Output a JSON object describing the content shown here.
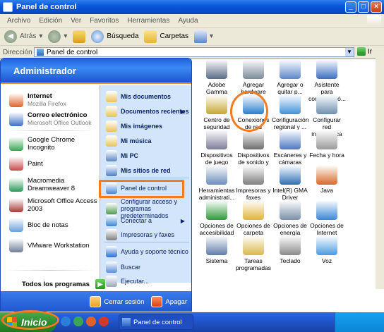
{
  "window": {
    "title": "Panel de control",
    "menus": [
      "Archivo",
      "Edición",
      "Ver",
      "Favoritos",
      "Herramientas",
      "Ayuda"
    ],
    "toolbar": {
      "back": "Atrás",
      "search": "Búsqueda",
      "folders": "Carpetas"
    },
    "address_label": "Dirección",
    "address_value": "Panel de control",
    "go": "Ir"
  },
  "control_panel": {
    "items": [
      {
        "label": "Adobe Gamma",
        "icon": "monitor-icon",
        "color": "#5a6d86"
      },
      {
        "label": "Agregar hardware",
        "icon": "hardware-icon",
        "color": "#7b8b99"
      },
      {
        "label": "Agregar o quitar p...",
        "icon": "cd-box-icon",
        "color": "#5e88c8"
      },
      {
        "label": "Asistente para configuració...",
        "icon": "wizard-icon",
        "color": "#3c6fbf"
      },
      {
        "label": "Centro de seguridad",
        "icon": "shield-icon",
        "color": "#c7a634"
      },
      {
        "label": "Conexiones de red",
        "icon": "globe-network-icon",
        "color": "#2c7ecf"
      },
      {
        "label": "Configuración regional y ...",
        "icon": "globe-icon",
        "color": "#3f91d8"
      },
      {
        "label": "Configurar red inalámbrica",
        "icon": "wireless-icon",
        "color": "#6f8fb0"
      },
      {
        "label": "Dispositivos de juego",
        "icon": "joystick-icon",
        "color": "#7d7d9a"
      },
      {
        "label": "Dispositivos de sonido y audio",
        "icon": "speaker-icon",
        "color": "#6e6e6e"
      },
      {
        "label": "Escáneres y cámaras",
        "icon": "scanner-icon",
        "color": "#4b79c3"
      },
      {
        "label": "Fecha y hora",
        "icon": "clock-icon",
        "color": "#9a9a9a"
      },
      {
        "label": "Herramientas administrati...",
        "icon": "admin-tools-icon",
        "color": "#6d8db8"
      },
      {
        "label": "Impresoras y faxes",
        "icon": "printer-icon",
        "color": "#7f7f7f"
      },
      {
        "label": "Intel(R) GMA Driver",
        "icon": "intel-icon",
        "color": "#2f6fb5"
      },
      {
        "label": "Java",
        "icon": "java-icon",
        "color": "#d86a2a"
      },
      {
        "label": "Opciones de accesibilidad",
        "icon": "accessibility-icon",
        "color": "#2f9a3a"
      },
      {
        "label": "Opciones de carpeta",
        "icon": "folder-options-icon",
        "color": "#e0b43a"
      },
      {
        "label": "Opciones de energía",
        "icon": "power-icon",
        "color": "#7b8fa8"
      },
      {
        "label": "Opciones de Internet",
        "icon": "internet-icon",
        "color": "#3a87d4"
      },
      {
        "label": "Sistema",
        "icon": "system-icon",
        "color": "#5f7da8"
      },
      {
        "label": "Tareas programadas",
        "icon": "scheduled-tasks-icon",
        "color": "#d9b84a"
      },
      {
        "label": "Teclado",
        "icon": "keyboard-icon",
        "color": "#8a8a8a"
      },
      {
        "label": "Voz",
        "icon": "voice-icon",
        "color": "#4a9ae0"
      }
    ]
  },
  "start_menu": {
    "user": "Administrador",
    "pinned": [
      {
        "title": "Internet",
        "subtitle": "Mozilla Firefox",
        "icon": "firefox-icon",
        "color": "#e0622a"
      },
      {
        "title": "Correo electrónico",
        "subtitle": "Microsoft Office Outlook",
        "icon": "outlook-icon",
        "color": "#3d6fc4"
      }
    ],
    "recent": [
      {
        "label": "Google Chrome Incognito",
        "icon": "chrome-icon",
        "color": "#3aa757"
      },
      {
        "label": "Paint",
        "icon": "paint-icon",
        "color": "#c94a4a"
      },
      {
        "label": "Macromedia Dreamweaver 8",
        "icon": "dreamweaver-icon",
        "color": "#2e9a5a"
      },
      {
        "label": "Microsoft Office Access 2003",
        "icon": "access-icon",
        "color": "#a83a3a"
      },
      {
        "label": "Bloc de notas",
        "icon": "notepad-icon",
        "color": "#6aa0d8"
      },
      {
        "label": "VMware Workstation",
        "icon": "vmware-icon",
        "color": "#6f7f99"
      }
    ],
    "all_programs": "Todos los programas",
    "right": [
      {
        "label": "Mis documentos",
        "bold": true,
        "icon": "my-documents-icon",
        "color": "#e8c35a"
      },
      {
        "label": "Documentos recientes",
        "bold": true,
        "arrow": true,
        "icon": "recent-docs-icon",
        "color": "#e8c35a"
      },
      {
        "label": "Mis imágenes",
        "bold": true,
        "icon": "my-pictures-icon",
        "color": "#e8c35a"
      },
      {
        "label": "Mi música",
        "bold": true,
        "icon": "my-music-icon",
        "color": "#e8c35a"
      },
      {
        "label": "Mi PC",
        "bold": true,
        "icon": "my-computer-icon",
        "color": "#5f84bf"
      },
      {
        "label": "Mis sitios de red",
        "bold": true,
        "icon": "network-places-icon",
        "color": "#4b7fc8"
      },
      {
        "label": "Panel de control",
        "bold": false,
        "icon": "control-panel-icon",
        "color": "#4b86d6"
      },
      {
        "label": "Configurar acceso y programas predeterminados",
        "bold": false,
        "icon": "default-programs-icon",
        "color": "#4f9a4f"
      },
      {
        "label": "Conectar a",
        "bold": false,
        "arrow": true,
        "icon": "connect-icon",
        "color": "#3a87d4"
      },
      {
        "label": "Impresoras y faxes",
        "bold": false,
        "icon": "printer-icon",
        "color": "#7f7f7f"
      },
      {
        "label": "Ayuda y soporte técnico",
        "bold": false,
        "icon": "help-icon",
        "color": "#2c6fcf"
      },
      {
        "label": "Buscar",
        "bold": false,
        "icon": "search-icon",
        "color": "#5a8ed6"
      },
      {
        "label": "Ejecutar...",
        "bold": false,
        "icon": "run-icon",
        "color": "#9aa9c0"
      }
    ],
    "log_off": "Cerrar sesión",
    "shut_down": "Apagar"
  },
  "taskbar": {
    "start": "Inicio",
    "task": "Panel de control"
  }
}
